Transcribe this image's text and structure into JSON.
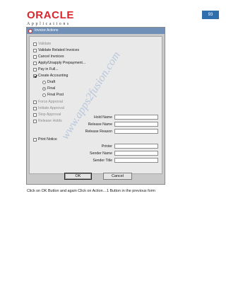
{
  "page": {
    "number": "93"
  },
  "logo": {
    "word": "ORACLE",
    "subtitle": "Applications"
  },
  "window": {
    "title": "Invoice Actions"
  },
  "actions": [
    {
      "label": "Validate",
      "checked": false,
      "enabled": false
    },
    {
      "label": "Validate Related Invoices",
      "checked": false,
      "enabled": true
    },
    {
      "label": "Cancel Invoices",
      "checked": false,
      "enabled": true
    },
    {
      "label": "Apply/Unapply Prepayment...",
      "checked": false,
      "enabled": true
    },
    {
      "label": "Pay in Full...",
      "checked": false,
      "enabled": true
    },
    {
      "label": "Create Accounting",
      "checked": true,
      "enabled": true
    }
  ],
  "accounting_modes": [
    {
      "label": "Draft",
      "selected": false
    },
    {
      "label": "Final",
      "selected": true
    },
    {
      "label": "Final Post",
      "selected": false
    }
  ],
  "approval_actions": [
    {
      "label": "Force Approval",
      "enabled": false
    },
    {
      "label": "Initiate Approval",
      "enabled": false
    },
    {
      "label": "Stop Approval",
      "enabled": false
    },
    {
      "label": "Release Holds",
      "enabled": false
    }
  ],
  "hold_fields": [
    {
      "label": "Hold Name",
      "value": ""
    },
    {
      "label": "Release Name",
      "value": ""
    },
    {
      "label": "Release Reason",
      "value": ""
    }
  ],
  "print_notice": {
    "label": "Print Notice",
    "checked": false
  },
  "notice_fields": [
    {
      "label": "Printer",
      "value": ""
    },
    {
      "label": "Sender Name",
      "value": ""
    },
    {
      "label": "Sender Title",
      "value": ""
    }
  ],
  "buttons": {
    "ok": "OK",
    "cancel": "Cancel"
  },
  "caption": "Click on OK Button and again Click on Action…1 Button in the previous form",
  "watermark": "www.apps2fusion.com",
  "colors": {
    "brand_red": "#d9262c",
    "titlebar_blue": "#7090b8",
    "page_number_bg": "#2f6fae",
    "watermark": "#b9c7dc"
  }
}
